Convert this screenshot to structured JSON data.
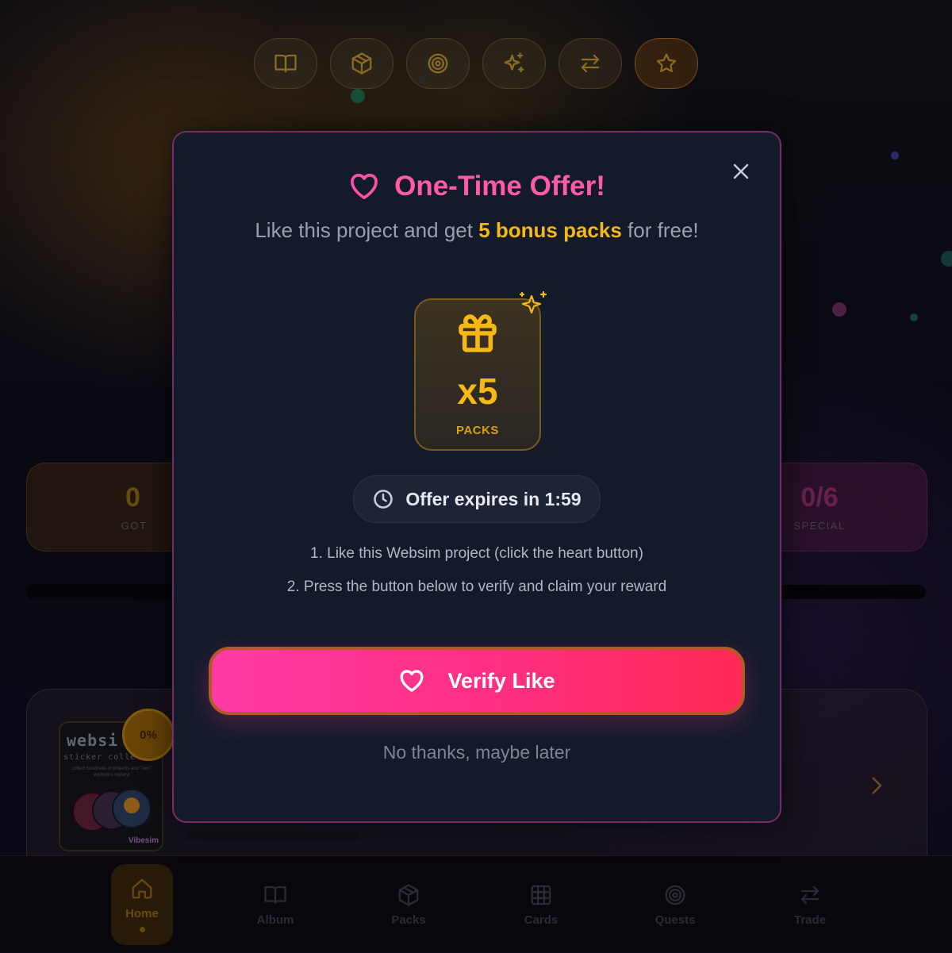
{
  "top_nav": {
    "buttons": [
      {
        "icon": "book-icon"
      },
      {
        "icon": "box-icon"
      },
      {
        "icon": "target-icon"
      },
      {
        "icon": "sparkles-icon"
      },
      {
        "icon": "swap-icon"
      },
      {
        "icon": "star-icon",
        "active": true
      }
    ]
  },
  "stats": {
    "got": {
      "value": "0",
      "label": "GOT"
    },
    "special": {
      "value": "0/6",
      "label": "SPECIAL"
    }
  },
  "album": {
    "cover_title": "websi",
    "cover_subtitle": "sticker colle",
    "cover_description": "collect hundreds of projects and \"own\" websim's history!",
    "cover_brand": "Vibesim",
    "progress_badge": "0%"
  },
  "bottom_nav": {
    "items": [
      {
        "label": "Home",
        "icon": "home-icon",
        "active": true
      },
      {
        "label": "Album",
        "icon": "book-icon"
      },
      {
        "label": "Packs",
        "icon": "box-icon"
      },
      {
        "label": "Cards",
        "icon": "grid-icon"
      },
      {
        "label": "Quests",
        "icon": "target-icon"
      },
      {
        "label": "Trade",
        "icon": "swap-icon"
      }
    ]
  },
  "modal": {
    "title": "One-Time Offer!",
    "subtitle_prefix": "Like this project and get ",
    "subtitle_highlight": "5 bonus packs",
    "subtitle_suffix": " for free!",
    "pack_count": "x5",
    "pack_label": "PACKS",
    "timer_text": "Offer expires in 1:59",
    "step1": "1. Like this Websim project (click the heart button)",
    "step2": "2. Press the button below to verify and claim your reward",
    "verify_label": "Verify Like",
    "decline_label": "No thanks, maybe later"
  },
  "colors": {
    "accent_pink": "#ff5aa8",
    "accent_gold": "#f5b814",
    "modal_bg": "#131a2a"
  }
}
